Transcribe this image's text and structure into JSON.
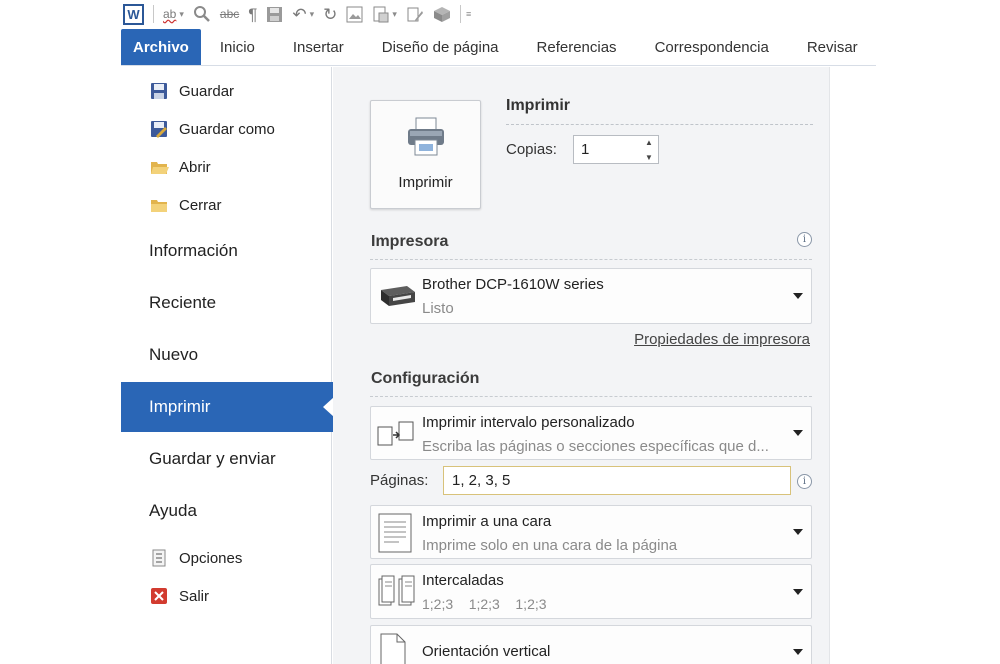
{
  "quick_access": {
    "word_logo": "W",
    "icons": [
      "spelling-icon",
      "find-icon",
      "strikethrough-icon",
      "paragraph-mark-icon",
      "save-icon",
      "undo-icon",
      "redo-icon",
      "image-icon",
      "page-layout-icon",
      "clear-format-icon",
      "insert-object-icon",
      "customize-toolbar-icon"
    ],
    "strike_label": "abc",
    "spell_label": "ab",
    "pilcrow": "¶"
  },
  "ribbon": {
    "tabs": [
      {
        "label": "Archivo",
        "active": true
      },
      {
        "label": "Inicio"
      },
      {
        "label": "Insertar"
      },
      {
        "label": "Diseño de página"
      },
      {
        "label": "Referencias"
      },
      {
        "label": "Correspondencia"
      },
      {
        "label": "Revisar"
      }
    ]
  },
  "nav": {
    "commands": [
      {
        "label": "Guardar",
        "icon": "save-icon"
      },
      {
        "label": "Guardar como",
        "icon": "save-as-icon"
      },
      {
        "label": "Abrir",
        "icon": "open-folder-icon"
      },
      {
        "label": "Cerrar",
        "icon": "close-folder-icon"
      }
    ],
    "sections": [
      {
        "label": "Información"
      },
      {
        "label": "Reciente"
      },
      {
        "label": "Nuevo"
      },
      {
        "label": "Imprimir",
        "active": true
      },
      {
        "label": "Guardar y enviar"
      },
      {
        "label": "Ayuda"
      }
    ],
    "bottom_commands": [
      {
        "label": "Opciones",
        "icon": "options-icon"
      },
      {
        "label": "Salir",
        "icon": "exit-icon"
      }
    ]
  },
  "print": {
    "button_label": "Imprimir",
    "heading": "Imprimir",
    "copies_label": "Copias:",
    "copies_value": "1"
  },
  "printer": {
    "heading": "Impresora",
    "name": "Brother DCP-1610W series",
    "status": "Listo",
    "properties_link": "Propiedades de impresora"
  },
  "settings": {
    "heading": "Configuración",
    "range": {
      "title": "Imprimir intervalo personalizado",
      "subtitle": "Escriba las páginas o secciones específicas que d..."
    },
    "pages_label": "Páginas:",
    "pages_value": "1, 2, 3, 5",
    "sides": {
      "title": "Imprimir a una cara",
      "subtitle": "Imprime solo en una cara de la página"
    },
    "collate": {
      "title": "Intercaladas",
      "subtitle": "1;2;3    1;2;3    1;2;3"
    },
    "orientation": {
      "title": "Orientación vertical"
    }
  },
  "colors": {
    "accent": "#2a66b6",
    "pane_bg": "#f3f4f6",
    "input_border_focus": "#d8c27a"
  }
}
